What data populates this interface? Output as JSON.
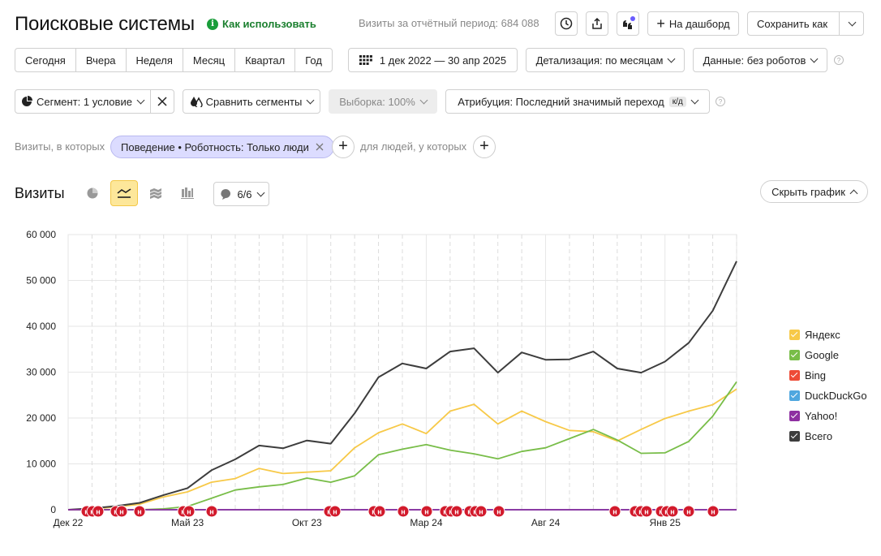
{
  "header": {
    "title": "Поисковые системы",
    "howto_label": "Как использовать",
    "visits_total": "Визиты за отчётный период: 684 088",
    "dashboard_label": "На дашборд",
    "save_label": "Сохранить как"
  },
  "period_tabs": [
    "Сегодня",
    "Вчера",
    "Неделя",
    "Месяц",
    "Квартал",
    "Год"
  ],
  "date_range": "1 дек 2022 — 30 апр 2025",
  "detail_label": "Детализация: по месяцам",
  "data_label": "Данные: без роботов",
  "segment_label": "Сегмент: 1 условие",
  "compare_label": "Сравнить сегменты",
  "sample_label": "Выборка: 100%",
  "attribution_label": "Атрибуция: Последний значимый переход",
  "attribution_badge": "к/д",
  "filter": {
    "prefix": "Визиты, в которых",
    "chip": "Поведение • Роботность: Только люди",
    "people": "для людей, у которых"
  },
  "chart_section": {
    "title": "Визиты",
    "annotations_count": "6/6",
    "hide_label": "Скрыть график"
  },
  "chart_data": {
    "type": "line",
    "x": [
      "2022-12",
      "2023-01",
      "2023-02",
      "2023-03",
      "2023-04",
      "2023-05",
      "2023-06",
      "2023-07",
      "2023-08",
      "2023-09",
      "2023-10",
      "2023-11",
      "2023-12",
      "2024-01",
      "2024-02",
      "2024-03",
      "2024-04",
      "2024-05",
      "2024-06",
      "2024-07",
      "2024-08",
      "2024-09",
      "2024-10",
      "2024-11",
      "2024-12",
      "2025-01",
      "2025-02",
      "2025-03",
      "2025-04"
    ],
    "x_tick_labels": [
      {
        "index": 0,
        "label": "Дек 22"
      },
      {
        "index": 5,
        "label": "Май 23"
      },
      {
        "index": 10,
        "label": "Окт 23"
      },
      {
        "index": 15,
        "label": "Мар 24"
      },
      {
        "index": 20,
        "label": "Авг 24"
      },
      {
        "index": 25,
        "label": "Янв 25"
      }
    ],
    "ylim": [
      0,
      60000
    ],
    "y_ticks": [
      0,
      10000,
      20000,
      30000,
      40000,
      50000,
      60000
    ],
    "y_tick_labels": [
      "0",
      "10 000",
      "20 000",
      "30 000",
      "40 000",
      "50 000",
      "60 000"
    ],
    "series": [
      {
        "name": "Яндекс",
        "color": "#f7c948",
        "values": [
          0,
          200,
          600,
          1200,
          2800,
          3900,
          6000,
          6800,
          9000,
          7900,
          8200,
          8500,
          13500,
          16800,
          18700,
          16600,
          21500,
          23000,
          18700,
          21500,
          19200,
          17300,
          17000,
          15000,
          17500,
          19900,
          21500,
          22900,
          26300
        ]
      },
      {
        "name": "Google",
        "color": "#78bd48",
        "values": [
          0,
          0,
          0,
          0,
          200,
          700,
          2500,
          4300,
          5000,
          5500,
          6900,
          6000,
          7400,
          12000,
          13200,
          14200,
          13000,
          12200,
          11100,
          12700,
          13500,
          15500,
          17500,
          15200,
          12300,
          12400,
          14900,
          20400,
          27900
        ]
      },
      {
        "name": "Bing",
        "color": "#ee4b36",
        "values": [
          0,
          0,
          0,
          0,
          0,
          0,
          0,
          0,
          0,
          0,
          0,
          0,
          0,
          0,
          0,
          0,
          0,
          0,
          0,
          0,
          0,
          0,
          0,
          0,
          0,
          0,
          0,
          0,
          0
        ]
      },
      {
        "name": "DuckDuckGo",
        "color": "#4fa7df",
        "values": [
          0,
          0,
          0,
          0,
          0,
          0,
          0,
          0,
          0,
          0,
          0,
          0,
          0,
          0,
          0,
          0,
          0,
          0,
          0,
          0,
          0,
          0,
          0,
          0,
          0,
          0,
          0,
          0,
          0
        ]
      },
      {
        "name": "Yahoo!",
        "color": "#8e2fa1",
        "values": [
          0,
          0,
          0,
          0,
          0,
          0,
          0,
          0,
          0,
          0,
          0,
          0,
          0,
          0,
          0,
          0,
          0,
          0,
          0,
          0,
          0,
          0,
          0,
          0,
          0,
          0,
          0,
          0,
          0
        ]
      },
      {
        "name": "Всего",
        "color": "#3d3d3d",
        "values": [
          0,
          300,
          800,
          1500,
          3200,
          4700,
          8600,
          11000,
          14000,
          13400,
          15100,
          14400,
          21000,
          28900,
          31900,
          30800,
          34500,
          35200,
          29900,
          34300,
          32700,
          32800,
          34500,
          30800,
          29900,
          32300,
          36400,
          43400,
          54200
        ]
      }
    ],
    "legend_position": "right",
    "grid": true,
    "annotation_marker_label": "н"
  }
}
